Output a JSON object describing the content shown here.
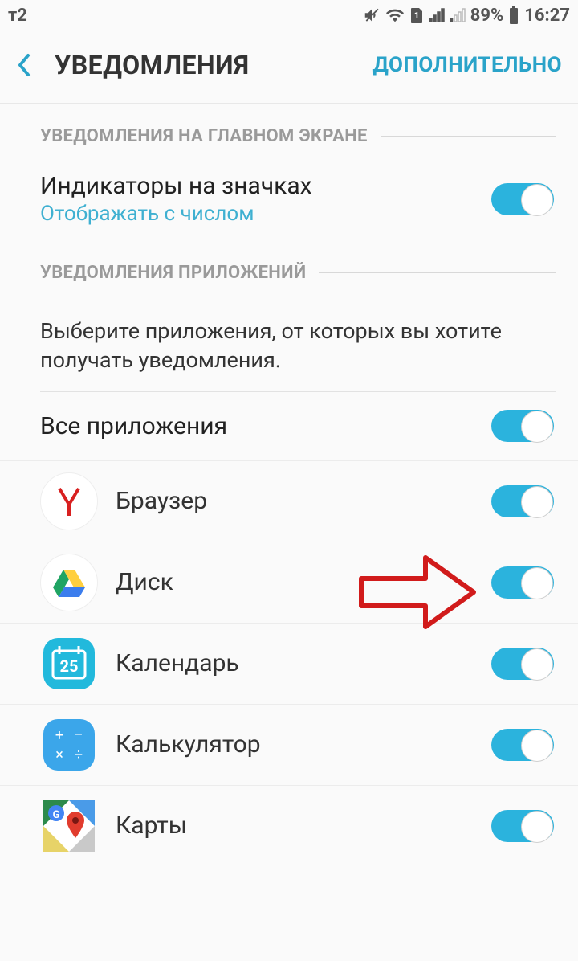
{
  "status": {
    "carrier": "т2",
    "battery_percent": "89%",
    "time": "16:27"
  },
  "header": {
    "title": "УВЕДОМЛЕНИЯ",
    "action": "ДОПОЛНИТЕЛЬНО"
  },
  "section1": {
    "label": "УВЕДОМЛЕНИЯ НА ГЛАВНОМ ЭКРАНЕ",
    "badge_title": "Индикаторы на значках",
    "badge_sub": "Отображать с числом",
    "badge_toggle": true
  },
  "section2": {
    "label": "УВЕДОМЛЕНИЯ ПРИЛОЖЕНИЙ",
    "description": "Выберите приложения, от которых вы хотите получать уведомления.",
    "all_apps_label": "Все приложения",
    "all_apps_toggle": true,
    "apps": [
      {
        "name": "Браузер",
        "icon": "yandex-browser",
        "toggle": true
      },
      {
        "name": "Диск",
        "icon": "google-drive",
        "toggle": true
      },
      {
        "name": "Календарь",
        "icon": "calendar",
        "toggle": true
      },
      {
        "name": "Калькулятор",
        "icon": "calculator",
        "toggle": true
      },
      {
        "name": "Карты",
        "icon": "google-maps",
        "toggle": true
      }
    ]
  }
}
